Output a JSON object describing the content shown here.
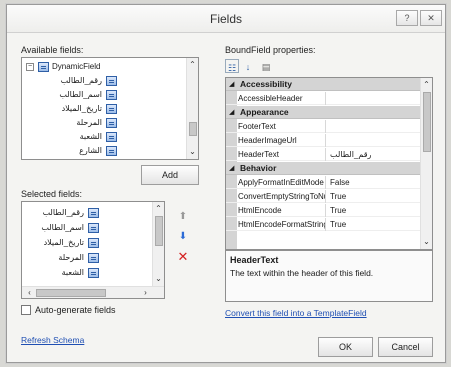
{
  "window": {
    "title": "Fields",
    "help_btn": "?",
    "close_btn": "✕"
  },
  "available": {
    "label": "Available fields:",
    "root": "DynamicField",
    "items": [
      "رقم_الطالب",
      "اسم_الطالب",
      "تاريخ_الميلاد",
      "المرحلة",
      "الشعبة",
      "الشارع"
    ]
  },
  "add_label": "Add",
  "selected": {
    "label": "Selected fields:",
    "items": [
      "رقم_الطالب",
      "اسم_الطالب",
      "تاريخ_الميلاد",
      "المرحلة",
      "الشعبة"
    ]
  },
  "auto_generate_label": "Auto-generate fields",
  "refresh_label": "Refresh Schema",
  "properties": {
    "label": "BoundField properties:",
    "categories": [
      {
        "name": "Accessibility",
        "rows": [
          {
            "name": "AccessibleHeader",
            "value": ""
          }
        ]
      },
      {
        "name": "Appearance",
        "rows": [
          {
            "name": "FooterText",
            "value": ""
          },
          {
            "name": "HeaderImageUrl",
            "value": ""
          },
          {
            "name": "HeaderText",
            "value": "رقم_الطالب"
          }
        ]
      },
      {
        "name": "Behavior",
        "rows": [
          {
            "name": "ApplyFormatInEditMode",
            "value": "False"
          },
          {
            "name": "ConvertEmptyStringToNull",
            "value": "True"
          },
          {
            "name": "HtmlEncode",
            "value": "True"
          },
          {
            "name": "HtmlEncodeFormatString",
            "value": "True"
          }
        ]
      }
    ],
    "desc_title": "HeaderText",
    "desc_text": "The text within the header of this field."
  },
  "convert_link": "Convert this field into a TemplateField",
  "ok_label": "OK",
  "cancel_label": "Cancel"
}
